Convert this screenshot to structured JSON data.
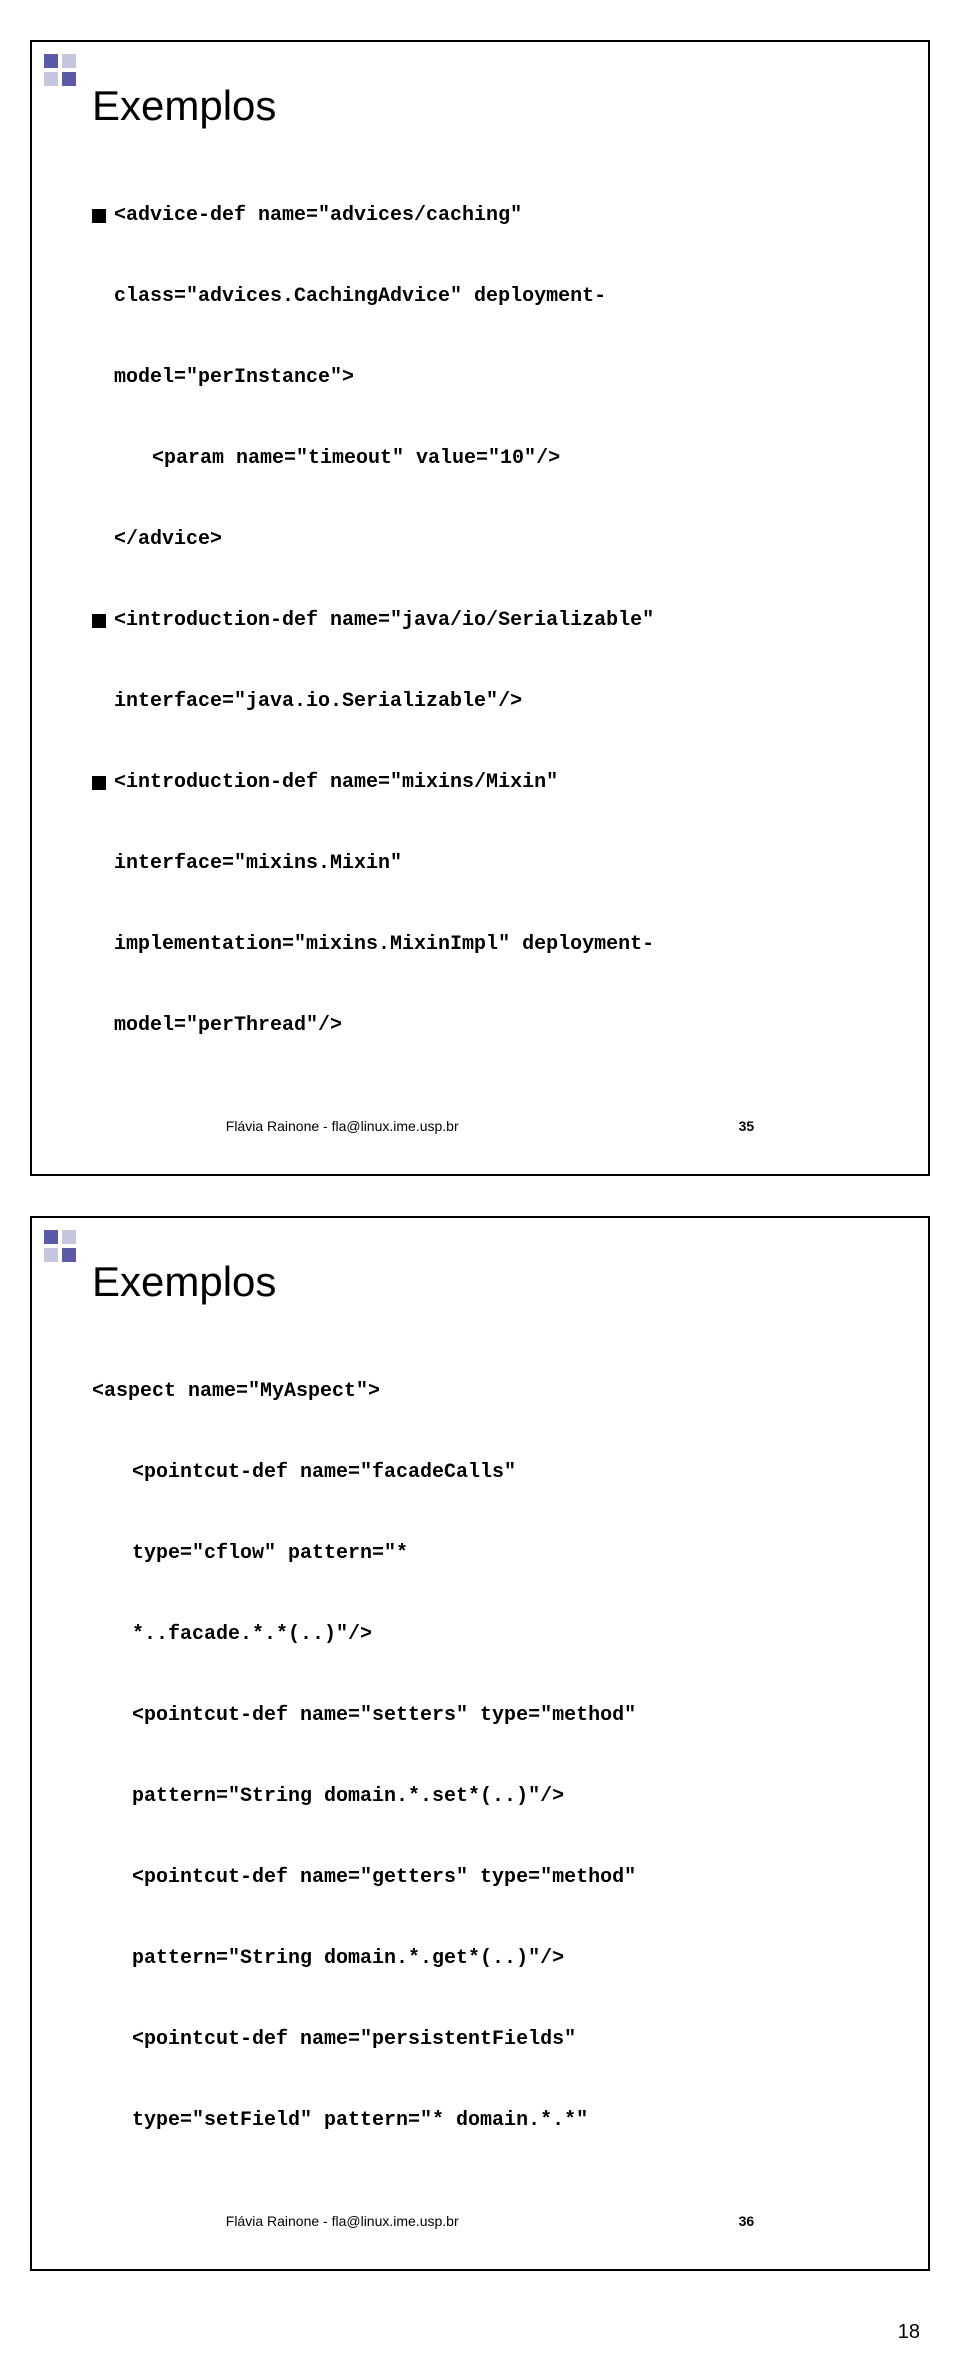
{
  "slide1": {
    "title": "Exemplos",
    "line1": "<advice-def name=\"advices/caching\"",
    "line2": "class=\"advices.CachingAdvice\" deployment-",
    "line3": "model=\"perInstance\">",
    "line4": "<param name=\"timeout\" value=\"10\"/>",
    "line5": "</advice>",
    "line6": "<introduction-def name=\"java/io/Serializable\"",
    "line7": "interface=\"java.io.Serializable\"/>",
    "line8": "<introduction-def name=\"mixins/Mixin\"",
    "line9": "interface=\"mixins.Mixin\"",
    "line10": "implementation=\"mixins.MixinImpl\" deployment-",
    "line11": "model=\"perThread\"/>",
    "footer_author": "Flávia Rainone - fla@linux.ime.usp.br",
    "footer_num": "35"
  },
  "slide2": {
    "title": "Exemplos",
    "line1": "<aspect name=\"MyAspect\">",
    "line2": "<pointcut-def name=\"facadeCalls\"",
    "line3": "type=\"cflow\" pattern=\"*",
    "line4": "*..facade.*.*(..)\"/>",
    "line5": "<pointcut-def name=\"setters\" type=\"method\"",
    "line6": "pattern=\"String domain.*.set*(..)\"/>",
    "line7": "<pointcut-def name=\"getters\" type=\"method\"",
    "line8": "pattern=\"String domain.*.get*(..)\"/>",
    "line9": "<pointcut-def name=\"persistentFields\"",
    "line10": "type=\"setField\" pattern=\"* domain.*.*\"",
    "footer_author": "Flávia Rainone - fla@linux.ime.usp.br",
    "footer_num": "36"
  },
  "page_number": "18"
}
